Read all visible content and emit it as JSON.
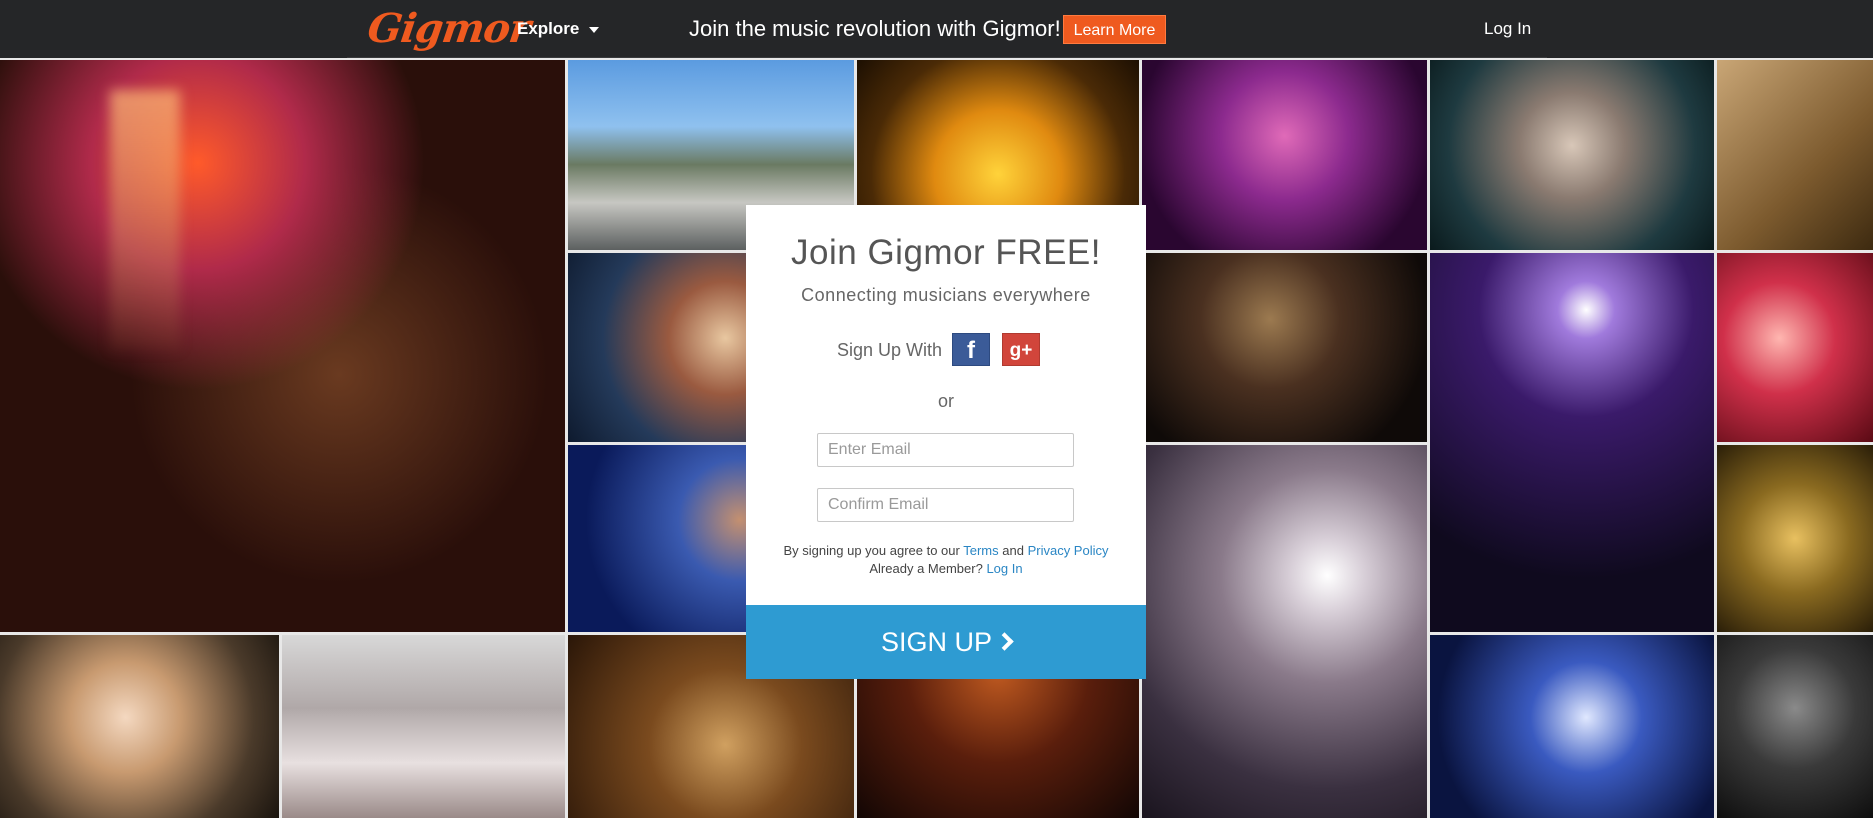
{
  "header": {
    "logo_text": "Gigmor",
    "explore_label": "Explore",
    "promo_text": "Join the music revolution with Gigmor!",
    "learn_more_label": "Learn More",
    "login_label": "Log In"
  },
  "signup": {
    "title": "Join Gigmor FREE!",
    "subtitle": "Connecting musicians everywhere",
    "signup_with_label": "Sign Up With",
    "facebook_label": "f",
    "google_label": "g+",
    "or_label": "or",
    "email_placeholder": "Enter Email",
    "confirm_email_placeholder": "Confirm Email",
    "legal_prefix": "By signing up you agree to our",
    "terms_label": "Terms",
    "legal_and": "and",
    "privacy_label": "Privacy Policy",
    "member_prefix": "Already a Member?",
    "member_login_label": "Log In",
    "signup_button_label": "SIGN UP"
  },
  "colors": {
    "brand_orange": "#ef5a1f",
    "signup_blue": "#2e9bd2",
    "facebook_blue": "#3b5b98",
    "google_red": "#d1453b",
    "link_blue": "#2a86c4",
    "nav_bg": "#252628"
  }
}
